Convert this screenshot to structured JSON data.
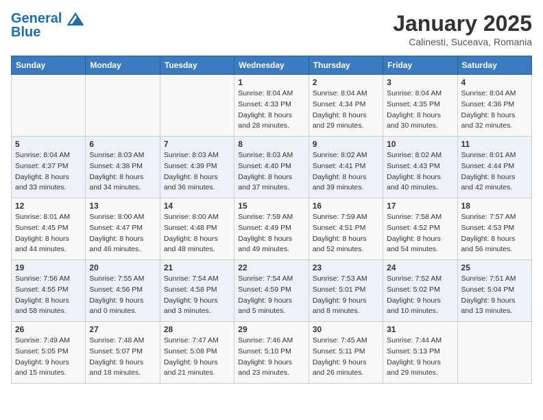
{
  "header": {
    "logo_line1": "General",
    "logo_line2": "Blue",
    "title": "January 2025",
    "subtitle": "Calinesti, Suceava, Romania"
  },
  "weekdays": [
    "Sunday",
    "Monday",
    "Tuesday",
    "Wednesday",
    "Thursday",
    "Friday",
    "Saturday"
  ],
  "weeks": [
    [
      {
        "day": "",
        "info": ""
      },
      {
        "day": "",
        "info": ""
      },
      {
        "day": "",
        "info": ""
      },
      {
        "day": "1",
        "info": "Sunrise: 8:04 AM\nSunset: 4:33 PM\nDaylight: 8 hours\nand 28 minutes."
      },
      {
        "day": "2",
        "info": "Sunrise: 8:04 AM\nSunset: 4:34 PM\nDaylight: 8 hours\nand 29 minutes."
      },
      {
        "day": "3",
        "info": "Sunrise: 8:04 AM\nSunset: 4:35 PM\nDaylight: 8 hours\nand 30 minutes."
      },
      {
        "day": "4",
        "info": "Sunrise: 8:04 AM\nSunset: 4:36 PM\nDaylight: 8 hours\nand 32 minutes."
      }
    ],
    [
      {
        "day": "5",
        "info": "Sunrise: 8:04 AM\nSunset: 4:37 PM\nDaylight: 8 hours\nand 33 minutes."
      },
      {
        "day": "6",
        "info": "Sunrise: 8:03 AM\nSunset: 4:38 PM\nDaylight: 8 hours\nand 34 minutes."
      },
      {
        "day": "7",
        "info": "Sunrise: 8:03 AM\nSunset: 4:39 PM\nDaylight: 8 hours\nand 36 minutes."
      },
      {
        "day": "8",
        "info": "Sunrise: 8:03 AM\nSunset: 4:40 PM\nDaylight: 8 hours\nand 37 minutes."
      },
      {
        "day": "9",
        "info": "Sunrise: 8:02 AM\nSunset: 4:41 PM\nDaylight: 8 hours\nand 39 minutes."
      },
      {
        "day": "10",
        "info": "Sunrise: 8:02 AM\nSunset: 4:43 PM\nDaylight: 8 hours\nand 40 minutes."
      },
      {
        "day": "11",
        "info": "Sunrise: 8:01 AM\nSunset: 4:44 PM\nDaylight: 8 hours\nand 42 minutes."
      }
    ],
    [
      {
        "day": "12",
        "info": "Sunrise: 8:01 AM\nSunset: 4:45 PM\nDaylight: 8 hours\nand 44 minutes."
      },
      {
        "day": "13",
        "info": "Sunrise: 8:00 AM\nSunset: 4:47 PM\nDaylight: 8 hours\nand 46 minutes."
      },
      {
        "day": "14",
        "info": "Sunrise: 8:00 AM\nSunset: 4:48 PM\nDaylight: 8 hours\nand 48 minutes."
      },
      {
        "day": "15",
        "info": "Sunrise: 7:59 AM\nSunset: 4:49 PM\nDaylight: 8 hours\nand 49 minutes."
      },
      {
        "day": "16",
        "info": "Sunrise: 7:59 AM\nSunset: 4:51 PM\nDaylight: 8 hours\nand 52 minutes."
      },
      {
        "day": "17",
        "info": "Sunrise: 7:58 AM\nSunset: 4:52 PM\nDaylight: 8 hours\nand 54 minutes."
      },
      {
        "day": "18",
        "info": "Sunrise: 7:57 AM\nSunset: 4:53 PM\nDaylight: 8 hours\nand 56 minutes."
      }
    ],
    [
      {
        "day": "19",
        "info": "Sunrise: 7:56 AM\nSunset: 4:55 PM\nDaylight: 8 hours\nand 58 minutes."
      },
      {
        "day": "20",
        "info": "Sunrise: 7:55 AM\nSunset: 4:56 PM\nDaylight: 9 hours\nand 0 minutes."
      },
      {
        "day": "21",
        "info": "Sunrise: 7:54 AM\nSunset: 4:58 PM\nDaylight: 9 hours\nand 3 minutes."
      },
      {
        "day": "22",
        "info": "Sunrise: 7:54 AM\nSunset: 4:59 PM\nDaylight: 9 hours\nand 5 minutes."
      },
      {
        "day": "23",
        "info": "Sunrise: 7:53 AM\nSunset: 5:01 PM\nDaylight: 9 hours\nand 8 minutes."
      },
      {
        "day": "24",
        "info": "Sunrise: 7:52 AM\nSunset: 5:02 PM\nDaylight: 9 hours\nand 10 minutes."
      },
      {
        "day": "25",
        "info": "Sunrise: 7:51 AM\nSunset: 5:04 PM\nDaylight: 9 hours\nand 13 minutes."
      }
    ],
    [
      {
        "day": "26",
        "info": "Sunrise: 7:49 AM\nSunset: 5:05 PM\nDaylight: 9 hours\nand 15 minutes."
      },
      {
        "day": "27",
        "info": "Sunrise: 7:48 AM\nSunset: 5:07 PM\nDaylight: 9 hours\nand 18 minutes."
      },
      {
        "day": "28",
        "info": "Sunrise: 7:47 AM\nSunset: 5:08 PM\nDaylight: 9 hours\nand 21 minutes."
      },
      {
        "day": "29",
        "info": "Sunrise: 7:46 AM\nSunset: 5:10 PM\nDaylight: 9 hours\nand 23 minutes."
      },
      {
        "day": "30",
        "info": "Sunrise: 7:45 AM\nSunset: 5:11 PM\nDaylight: 9 hours\nand 26 minutes."
      },
      {
        "day": "31",
        "info": "Sunrise: 7:44 AM\nSunset: 5:13 PM\nDaylight: 9 hours\nand 29 minutes."
      },
      {
        "day": "",
        "info": ""
      }
    ]
  ]
}
